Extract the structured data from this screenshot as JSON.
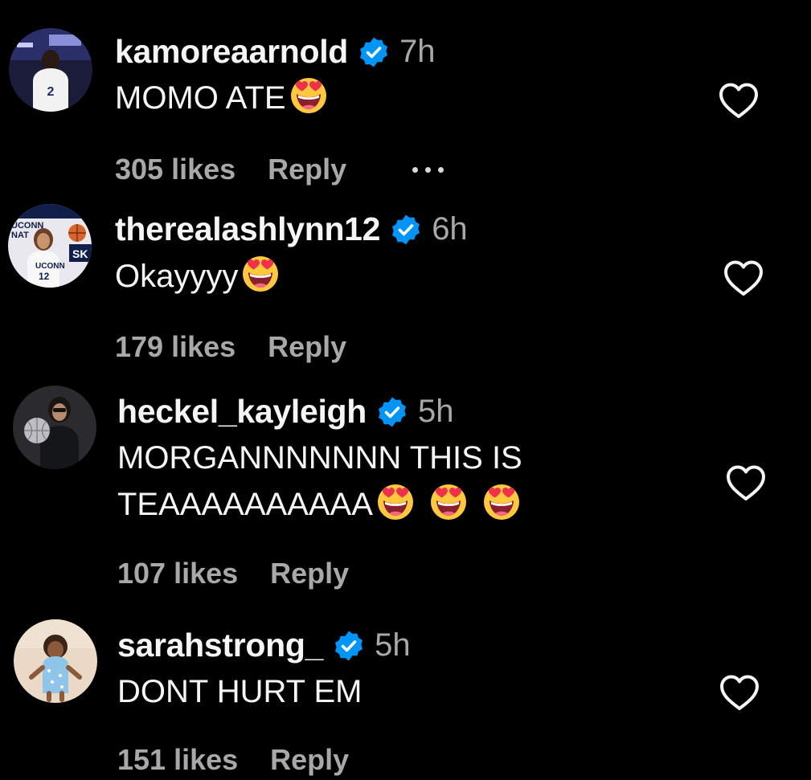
{
  "comments": [
    {
      "username": "kamoreaarnold",
      "time": "7h",
      "text": "MOMO ATE",
      "likes": "305 likes",
      "reply": "Reply"
    },
    {
      "username": "therealashlynn12",
      "time": "6h",
      "text": "Okayyyy",
      "likes": "179 likes",
      "reply": "Reply"
    },
    {
      "username": "heckel_kayleigh",
      "time": "5h",
      "text_line1": "MORGANNNNNNN THIS IS",
      "text_line2": "TEAAAAAAAAAA",
      "likes": "107 likes",
      "reply": "Reply"
    },
    {
      "username": "sarahstrong_",
      "time": "5h",
      "text": "DONT HURT EM",
      "likes": "151 likes",
      "reply": "Reply"
    }
  ],
  "icons": {
    "verified": "verified-badge-icon",
    "emoji": "heart-eyes-emoji",
    "like": "heart-outline-icon",
    "more": "more-options-icon"
  },
  "colors": {
    "background": "#000000",
    "primary_text": "#f5f5f5",
    "secondary_text": "#a8a8a8",
    "verified_blue": "#0095f6",
    "emoji_yellow": "#ffc83d"
  }
}
